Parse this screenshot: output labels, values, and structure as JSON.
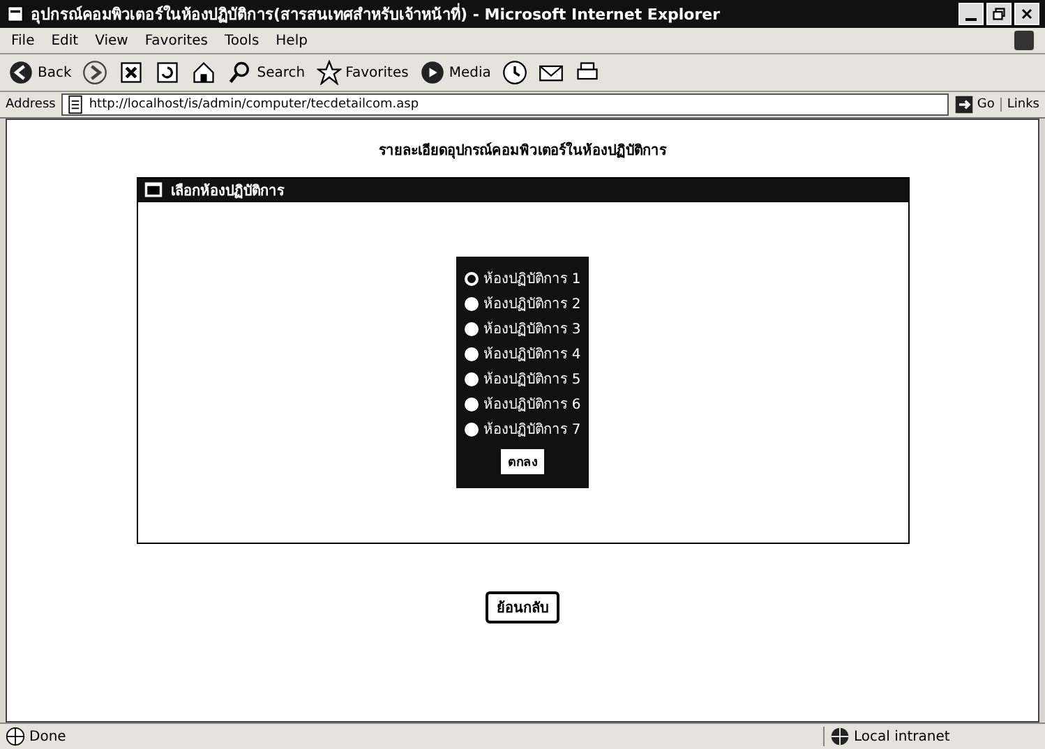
{
  "window": {
    "title": "อุปกรณ์คอมพิวเตอร์ในห้องปฏิบัติการ(สารสนเทศสำหรับเจ้าหน้าที่) - Microsoft Internet Explorer"
  },
  "menu": [
    "File",
    "Edit",
    "View",
    "Favorites",
    "Tools",
    "Help"
  ],
  "toolbar": [
    {
      "kind": "back",
      "label": "Back"
    },
    {
      "kind": "forward"
    },
    {
      "kind": "stop"
    },
    {
      "kind": "refresh"
    },
    {
      "kind": "home"
    },
    {
      "kind": "search",
      "label": "Search"
    },
    {
      "kind": "favorites",
      "label": "Favorites"
    },
    {
      "kind": "media",
      "label": "Media"
    },
    {
      "kind": "history"
    },
    {
      "kind": "mail"
    },
    {
      "kind": "print"
    }
  ],
  "address": {
    "label": "Address",
    "value": "http://localhost/is/admin/computer/tecdetailcom.asp",
    "go": "Go",
    "links": "Links"
  },
  "page": {
    "heading": "รายละเอียดอุปกรณ์คอมพิวเตอร์ในห้องปฏิบัติการ",
    "panel_title": "เลือกห้องปฏิบัติการ",
    "rooms": [
      {
        "label": "ห้องปฏิบัติการ 1",
        "selected": true
      },
      {
        "label": "ห้องปฏิบัติการ 2",
        "selected": false
      },
      {
        "label": "ห้องปฏิบัติการ 3",
        "selected": false
      },
      {
        "label": "ห้องปฏิบัติการ 4",
        "selected": false
      },
      {
        "label": "ห้องปฏิบัติการ 5",
        "selected": false
      },
      {
        "label": "ห้องปฏิบัติการ 6",
        "selected": false
      },
      {
        "label": "ห้องปฏิบัติการ 7",
        "selected": false
      }
    ],
    "ok_button": "ตกลง",
    "back_button": "ย้อนกลับ"
  },
  "status_bar": {
    "status": "Done",
    "zone": "Local intranet"
  }
}
